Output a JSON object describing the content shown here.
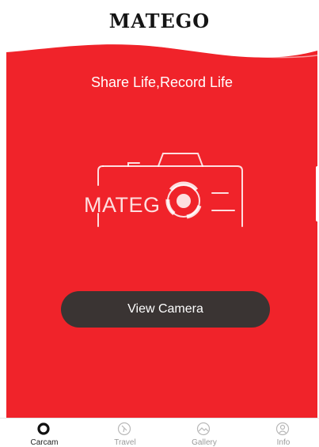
{
  "header": {
    "brand": "MATEGO"
  },
  "hero": {
    "slogan": "Share Life,Record Life",
    "camera_brand": "MATEG",
    "view_camera_label": "View Camera"
  },
  "tabs": [
    {
      "label": "Carcam",
      "icon": "carcam-icon",
      "active": true
    },
    {
      "label": "Travel",
      "icon": "travel-icon",
      "active": false
    },
    {
      "label": "Gallery",
      "icon": "gallery-icon",
      "active": false
    },
    {
      "label": "Info",
      "icon": "info-icon",
      "active": false
    }
  ],
  "colors": {
    "accent": "#f0232a",
    "button": "#3a3433",
    "tab_active": "#222222",
    "tab_inactive": "#9a9a9a"
  }
}
